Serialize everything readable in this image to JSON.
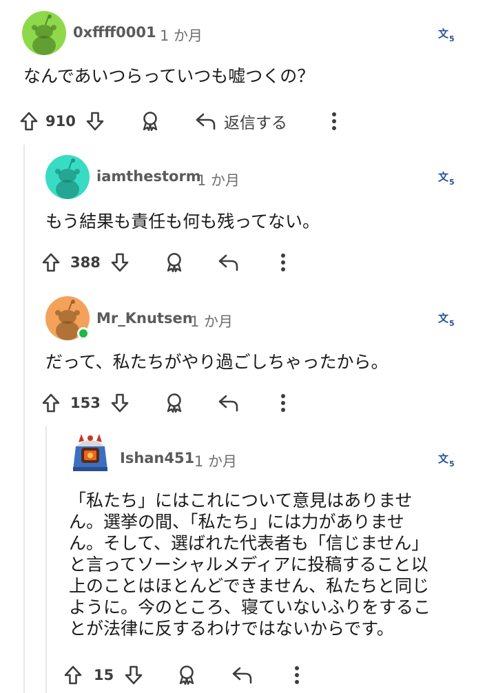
{
  "comments": [
    {
      "username": "0xffff0001",
      "time": "1 か月",
      "body": "なんであいつらっていつも嘘つくの？",
      "score": "910",
      "reply_label": "返信する",
      "avatar_color": "#8ed94a"
    },
    {
      "username": "iamthestorm",
      "time": "1 か月",
      "body": "もう結果も責任も何も残ってない。",
      "score": "388",
      "avatar_color": "#38dcc4"
    },
    {
      "username": "Mr_Knutsen",
      "time": "1 か月",
      "body": "だって、私たちがやり過ごしちゃったから。",
      "score": "153",
      "avatar_color": "#f4a25a",
      "online": true
    },
    {
      "username": "Ishan451",
      "time": "1 か月",
      "body_lines": [
        "「私たち」にはこれについて意見はありませ",
        "ん。選挙の間、「私たち」には力がありませ",
        "ん。そして、選ばれた代表者も「信じません」",
        "と言ってソーシャルメディアに投稿すること以",
        "上のことはほとんどできません、私たちと同じ",
        "ように。今のところ、寝ていないふりをするこ",
        "とが法律に反するわけではないからです。"
      ],
      "score": "15"
    }
  ],
  "colors": {
    "icon": "#3d3d3d",
    "translate": "#1f4e99",
    "thread_line": "#e6e6e6",
    "online": "#1db944"
  },
  "icons": [
    "upvote-icon",
    "downvote-icon",
    "award-icon",
    "reply-icon",
    "more-icon",
    "translate-icon"
  ]
}
